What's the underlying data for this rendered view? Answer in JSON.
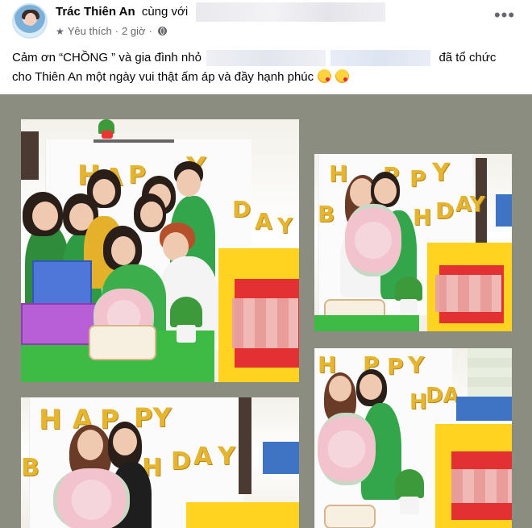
{
  "post": {
    "author": "Trác Thiên An",
    "with_text": "cùng với",
    "favorite_label": "Yêu thích",
    "separator": "·",
    "time": "2 giờ",
    "caption_line1_a": "Cảm ơn “CHỒNG ” và gia đình nhỏ",
    "caption_line1_b": "đã tổ chức",
    "caption_line2": "cho Thiên An một ngày vui thật ấm áp và đầy hạnh phúc"
  },
  "icons": {
    "more": "more-horizontal-icon",
    "favorite": "star-icon",
    "privacy": "globe-icon",
    "emoji": "kissing-face-emoji"
  },
  "photos": [
    {
      "balloons": "HAPPY BIRTHDAY"
    },
    {
      "balloons": "HAPPY BIRTHDAY"
    },
    {
      "balloons": "HAPPY BIRTHDAY"
    },
    {
      "balloons": "HAPPY BIRTHDAY"
    }
  ],
  "colors": {
    "background": "#ffffff",
    "gallery_bg": "#8a8d7f",
    "text_primary": "#050505",
    "text_secondary": "#65676b",
    "balloon_gold": "#e6b52f",
    "gift_yellow": "#ffd31f",
    "shirt_green": "#3dbb45"
  }
}
